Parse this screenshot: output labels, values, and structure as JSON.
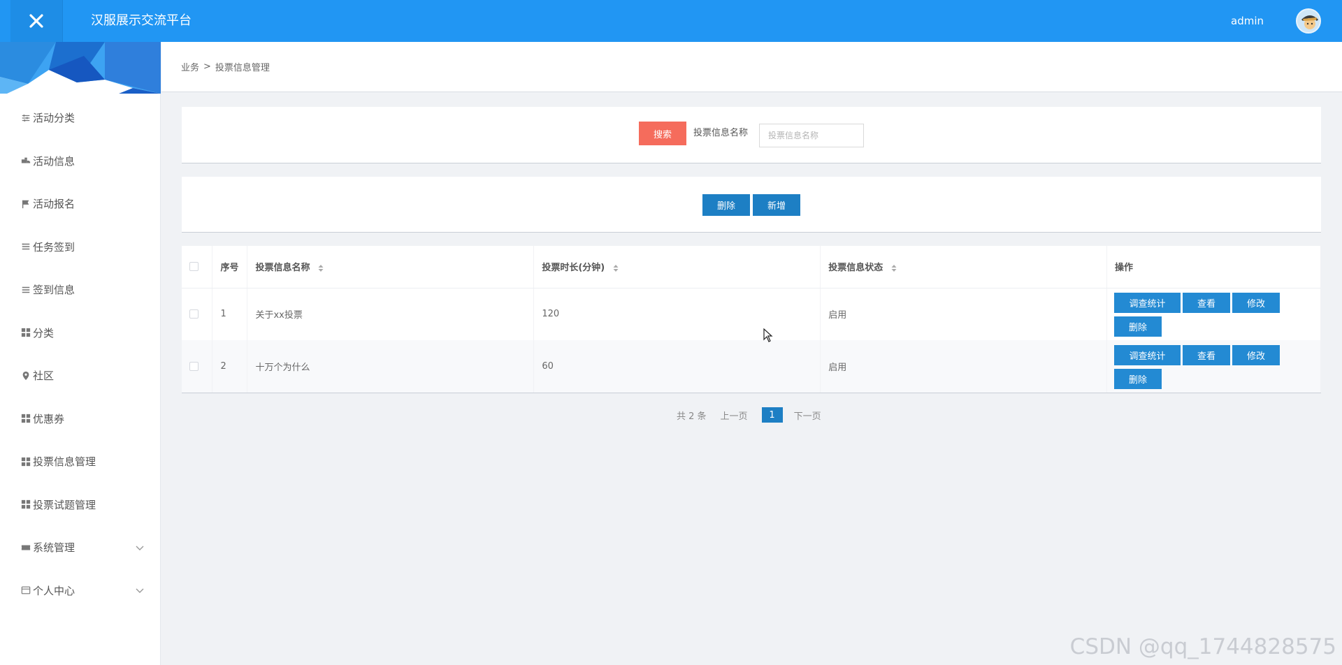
{
  "header": {
    "title": "汉服展示交流平台",
    "user": "admin"
  },
  "sidebar": {
    "items": [
      {
        "label": "活动分类",
        "icon": "sliders-icon"
      },
      {
        "label": "活动信息",
        "icon": "truck-icon"
      },
      {
        "label": "活动报名",
        "icon": "flag-icon"
      },
      {
        "label": "任务签到",
        "icon": "list-icon"
      },
      {
        "label": "签到信息",
        "icon": "list-icon"
      },
      {
        "label": "分类",
        "icon": "grid-icon"
      },
      {
        "label": "社区",
        "icon": "location-pin-icon"
      },
      {
        "label": "优惠券",
        "icon": "grid-icon"
      },
      {
        "label": "投票信息管理",
        "icon": "grid-icon"
      },
      {
        "label": "投票试题管理",
        "icon": "grid-icon"
      },
      {
        "label": "系统管理",
        "icon": "ticket-icon",
        "expandable": true
      },
      {
        "label": "个人中心",
        "icon": "card-icon",
        "expandable": true
      }
    ]
  },
  "breadcrumb": {
    "parent": "业务",
    "separator": ">",
    "current": "投票信息管理"
  },
  "search": {
    "button_label": "搜索",
    "field_label": "投票信息名称",
    "placeholder": "投票信息名称"
  },
  "actions": {
    "delete_label": "删除",
    "add_label": "新增"
  },
  "table": {
    "headers": {
      "index": "序号",
      "name": "投票信息名称",
      "duration": "投票时长(分钟)",
      "status": "投票信息状态",
      "ops": "操作"
    },
    "rows": [
      {
        "index": "1",
        "name": "关于xx投票",
        "duration": "120",
        "status": "启用"
      },
      {
        "index": "2",
        "name": "十万个为什么",
        "duration": "60",
        "status": "启用"
      }
    ],
    "row_actions": {
      "stats": "调查统计",
      "view": "查看",
      "edit": "修改",
      "delete": "删除"
    }
  },
  "pagination": {
    "total": "共 2 条",
    "prev": "上一页",
    "current": "1",
    "next": "下一页"
  },
  "watermark": "CSDN @qq_1744828575",
  "colors": {
    "primary": "#2196f3",
    "button_blue": "#1d7fc4",
    "search_red": "#f56c5c"
  }
}
